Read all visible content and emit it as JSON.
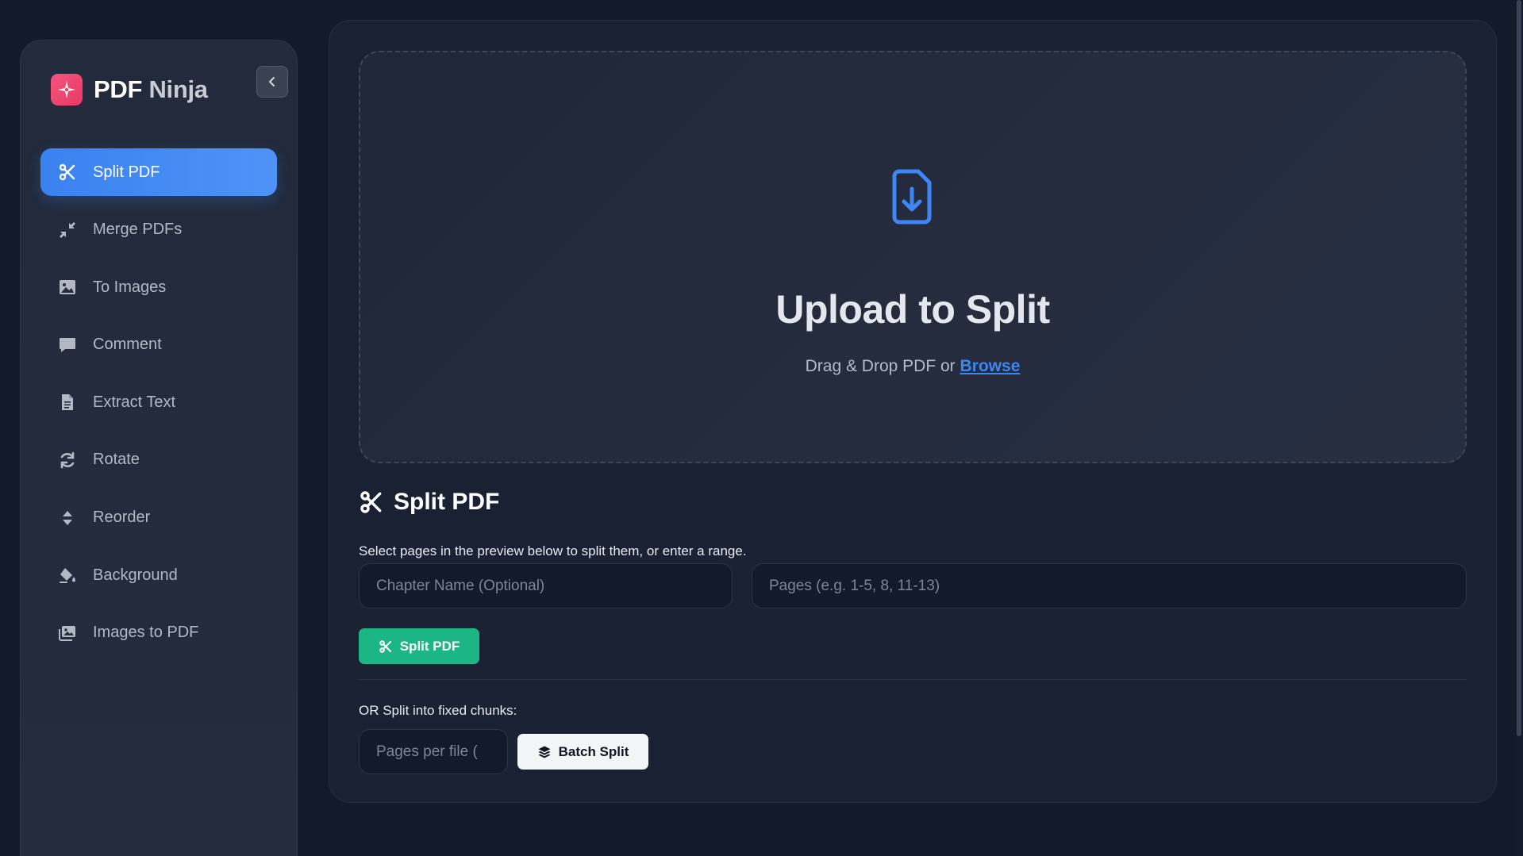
{
  "brand": {
    "name_primary": "PDF",
    "name_secondary": "Ninja",
    "logo_icon": "compass-star-icon",
    "logo_color": "#ee4572"
  },
  "sidebar": {
    "collapse_icon": "chevron-left-icon",
    "items": [
      {
        "label": "Split PDF",
        "icon": "scissors-icon",
        "active": true
      },
      {
        "label": "Merge PDFs",
        "icon": "compress-arrows-icon",
        "active": false
      },
      {
        "label": "To Images",
        "icon": "image-icon",
        "active": false
      },
      {
        "label": "Comment",
        "icon": "comment-icon",
        "active": false
      },
      {
        "label": "Extract Text",
        "icon": "file-text-icon",
        "active": false
      },
      {
        "label": "Rotate",
        "icon": "rotate-icon",
        "active": false
      },
      {
        "label": "Reorder",
        "icon": "sort-icon",
        "active": false
      },
      {
        "label": "Background",
        "icon": "paint-bucket-icon",
        "active": false
      },
      {
        "label": "Images to PDF",
        "icon": "images-icon",
        "active": false
      }
    ]
  },
  "upload": {
    "icon": "file-download-icon",
    "title": "Upload to Split",
    "subtitle_prefix": "Drag & Drop PDF or",
    "browse_label": "Browse"
  },
  "split_section": {
    "title": "Split PDF",
    "icon": "scissors-icon",
    "hint": "Select pages in the preview below to split them, or enter a range.",
    "chapter_placeholder": "Chapter Name (Optional)",
    "pages_placeholder": "Pages (e.g. 1-5, 8, 11-13)",
    "split_button_label": "Split PDF",
    "chunk_label": "OR Split into fixed chunks:",
    "chunk_placeholder": "Pages per file (",
    "batch_button_label": "Batch Split",
    "batch_icon": "layers-icon"
  },
  "colors": {
    "accent": "#3d86f3",
    "success": "#1cb584",
    "background": "#131a2a",
    "panel": "#192133"
  }
}
